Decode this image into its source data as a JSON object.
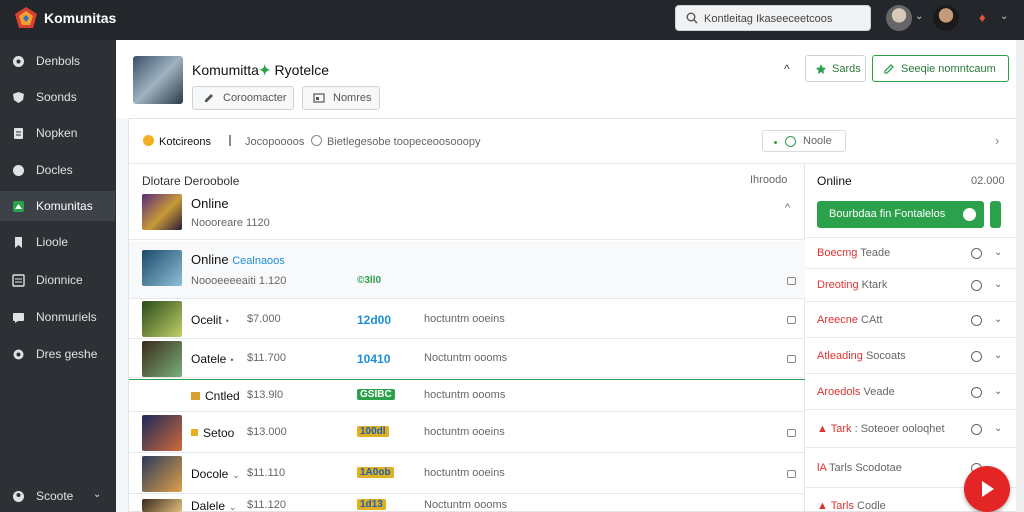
{
  "app": {
    "brand": "Komunitas"
  },
  "topbar": {
    "search_value": "Kontleitag Ikaseeceetcoos",
    "avatar_caret": "⌄",
    "flame_icon": "flame-icon",
    "menu_caret": "⌄"
  },
  "sidebar": {
    "items": [
      {
        "label": "Denbols",
        "icon": "dashboard-icon"
      },
      {
        "label": "Soonds",
        "icon": "shield-icon"
      },
      {
        "label": "Nopken",
        "icon": "document-icon"
      },
      {
        "label": "Docles",
        "icon": "circle-icon"
      },
      {
        "label": "Komunitas",
        "icon": "community-icon",
        "active": true
      },
      {
        "label": "Lioole",
        "icon": "bookmark-icon"
      },
      {
        "label": "Dionnice",
        "icon": "list-icon"
      },
      {
        "label": "Nonmuriels",
        "icon": "message-icon"
      },
      {
        "label": "Dres geshe",
        "icon": "gear-icon"
      }
    ],
    "footer": {
      "label": "Scoote",
      "chevron": "⌄"
    }
  },
  "header": {
    "title": "Komumitta",
    "title_mark": "✦",
    "title_suffix": "Ryotelce",
    "btn1": "Coroomacter",
    "btn2": "Nomres",
    "collapse": "^",
    "save_label": "Sards",
    "primary_label": "Seeqie nomntcaum"
  },
  "filter_bar": {
    "items": [
      "Kotcireons",
      "Jocopoooos",
      "Bietlegesobe toopeceoosooopy"
    ],
    "mode_label": "Noole",
    "next": "›"
  },
  "list": {
    "title": "Dlotare Deroobole",
    "title_right": "Ihroodo",
    "head_item": {
      "name": "Online",
      "sub": "Noooreare 1120",
      "caret": "^"
    },
    "rows": [
      {
        "name": "Online",
        "name_accent": "Cealnaoos",
        "num": "Noooeeeeaiti 1.120",
        "badge": "©3ll0",
        "badge_color": "#2ba14b",
        "desc": "",
        "thumb_a": "#1a4a6a",
        "thumb_b": "#8fc0d8"
      },
      {
        "name": "Ocelit",
        "num": "$7.000",
        "badge": "12d00",
        "badge_color": "#1c8fd6",
        "desc": "hoctuntm ooeins",
        "thumb_a": "#2a4a1a",
        "thumb_b": "#c0d068"
      },
      {
        "name": "Oatele",
        "num": "$11.700",
        "badge": "10410",
        "badge_color": "#1c8fd6",
        "desc": "Noctuntm oooms",
        "thumb_a": "#3a2a1a",
        "thumb_b": "#7ab07a"
      },
      {
        "name": "Cntled",
        "num": "$13.9l0",
        "badge": "GSIBC",
        "badge_color": "#2ba14b",
        "desc": "hoctuntm oooms",
        "thumb_a": "",
        "thumb_b": ""
      },
      {
        "name": "Setoo",
        "num": "$13.000",
        "badge": "100dl",
        "badge_color": "#1c8fd6",
        "desc": "hoctuntm ooeins",
        "thumb_a": "#1a2a5a",
        "thumb_b": "#d06a3a"
      },
      {
        "name": "Docole",
        "num": "$11.110",
        "badge": "1A0ob",
        "badge_color": "#1c8fd6",
        "desc": "hoctuntm ooeins",
        "thumb_a": "#2a3a5a",
        "thumb_b": "#e0a04a"
      },
      {
        "name": "Dalele",
        "num": "$11.120",
        "badge": "1d13",
        "badge_color": "#1c8fd6",
        "desc": "Noctuntm oooms",
        "thumb_a": "#3a2a1a",
        "thumb_b": "#e0c080"
      }
    ]
  },
  "side": {
    "title": "Online",
    "title_right": "02.000",
    "toggle_label": "Bourbdaa ﬁn Fontalelos",
    "rows": [
      {
        "red": "Boecmg",
        "grey": "Teade"
      },
      {
        "red": "Dreoting",
        "grey": "Ktark"
      },
      {
        "red": "Areecne",
        "grey": "CAtt"
      },
      {
        "red": "Atleading",
        "grey": "Socoats"
      },
      {
        "red": "Aroedols",
        "grey": "Veade"
      },
      {
        "red": "Tark",
        "grey": ": Soteoer ooloqhet"
      },
      {
        "red": "lA",
        "grey": "Tarls  Scodotae"
      },
      {
        "red": "Tarls",
        "grey": "Codle"
      }
    ]
  },
  "colors": {
    "accent": "#2ba14b",
    "danger": "#e32525",
    "sidebar": "#2d3136"
  }
}
